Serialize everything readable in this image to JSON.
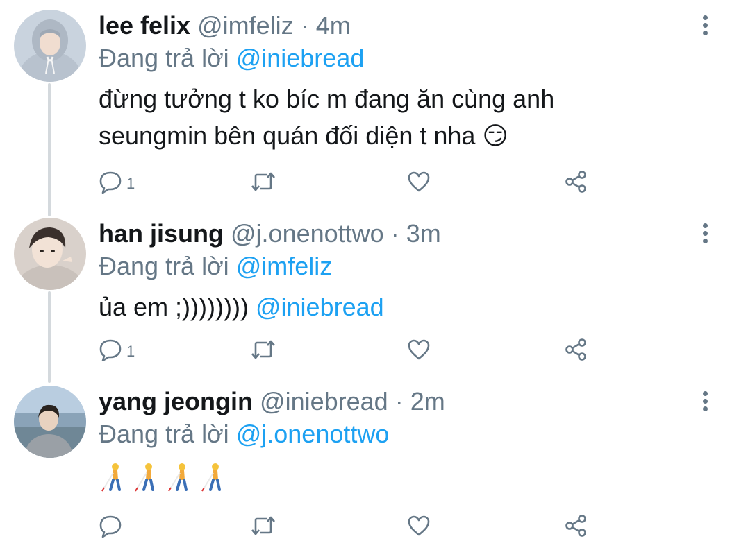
{
  "tweets": [
    {
      "name": "lee felix",
      "handle": "@imfeliz",
      "separator": "·",
      "time": "4m",
      "reply_prefix": "Đang trả lời",
      "reply_to": "@iniebread",
      "body_line1": "đừng tưởng t ko bíc m đang ăn cùng anh",
      "body_line2": "seungmin bên quán đối diện t nha 😏",
      "reply_count": "1"
    },
    {
      "name": "han jisung",
      "handle": "@j.onenottwo",
      "separator": "·",
      "time": "3m",
      "reply_prefix": "Đang trả lời",
      "reply_to": "@imfeliz",
      "body_text": "ủa em ;)))))))) ",
      "body_mention": "@iniebread",
      "reply_count": "1"
    },
    {
      "name": "yang jeongin",
      "handle": "@iniebread",
      "separator": "·",
      "time": "2m",
      "reply_prefix": "Đang trả lời",
      "reply_to": "@j.onenottwo",
      "reply_count": ""
    }
  ],
  "colors": {
    "name": "#14171a",
    "secondary": "#657786",
    "mention": "#1da1f2",
    "thread_line": "#d4d9dd"
  },
  "icons": [
    "reply-icon",
    "retweet-icon",
    "like-icon",
    "share-icon",
    "more-icon",
    "person-with-white-cane-emoji",
    "smirk-emoji"
  ]
}
